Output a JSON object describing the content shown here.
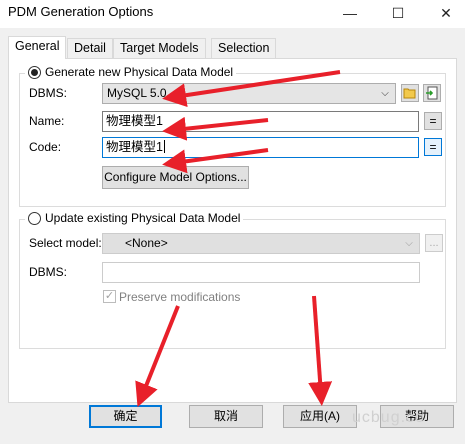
{
  "window": {
    "title": "PDM Generation Options",
    "minimize_glyph": "—",
    "maximize_glyph": "☐",
    "close_glyph": "✕"
  },
  "tabs": [
    {
      "label": "General",
      "active": true
    },
    {
      "label": "Detail",
      "active": false
    },
    {
      "label": "Target Models",
      "active": false
    },
    {
      "label": "Selection",
      "active": false
    }
  ],
  "generate_group": {
    "radio_label": "Generate new Physical Data Model",
    "selected": true,
    "dbms_label": "DBMS:",
    "dbms_value": "MySQL 5.0",
    "name_label": "Name:",
    "name_value": "物理模型1",
    "code_label": "Code:",
    "code_value": "物理模型1",
    "eq_glyph": "=",
    "configure_button": "Configure Model Options..."
  },
  "update_group": {
    "radio_label": "Update existing Physical Data Model",
    "selected": false,
    "select_model_label": "Select model:",
    "select_model_value": "<None>",
    "browse_glyph": "...",
    "dbms_label": "DBMS:",
    "dbms_value": "",
    "preserve_label": "Preserve modifications",
    "preserve_checked": true
  },
  "footer": {
    "ok": "确定",
    "cancel": "取消",
    "apply": "应用(A)",
    "help": "帮助"
  },
  "watermark": "ucbug.co",
  "colors": {
    "annotation_arrow": "#e8202a",
    "focus_blue": "#0078d7"
  }
}
